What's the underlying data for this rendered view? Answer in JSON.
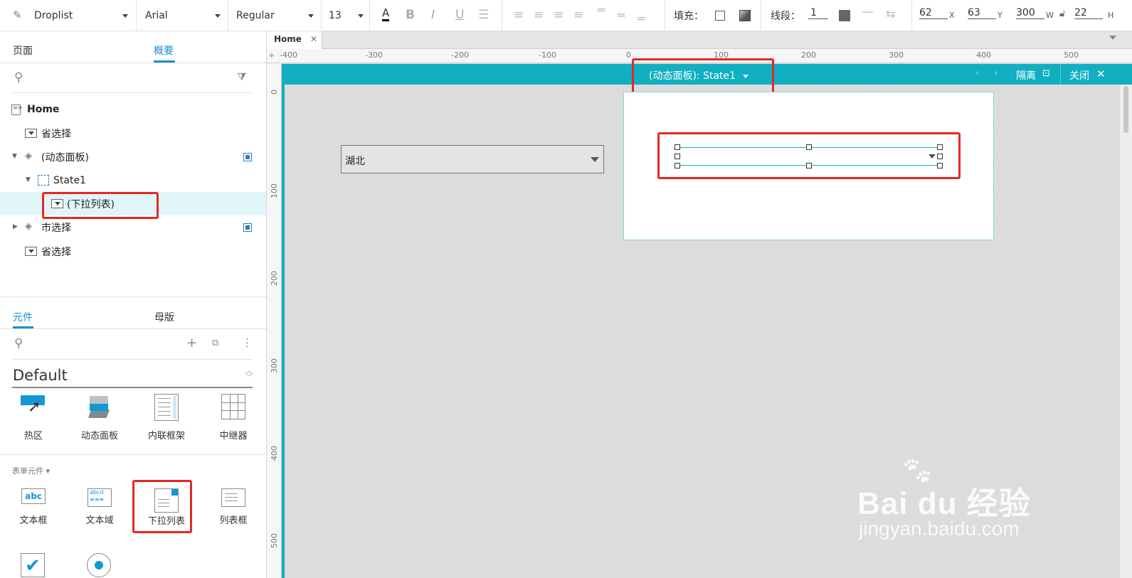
{
  "toolbar": {
    "widget_type": "Droplist",
    "font_family": "Arial",
    "font_style": "Regular",
    "font_size": "13",
    "fill_label": "填充：",
    "stroke_label": "线段：",
    "stroke_value": "1",
    "x_value": "62",
    "x_label": "X",
    "y_value": "63",
    "y_label": "Y",
    "w_value": "300",
    "w_label": "W",
    "h_value": "22",
    "h_label": "H"
  },
  "left_panel": {
    "top_tabs": [
      "页面",
      "概要"
    ],
    "outline": [
      {
        "label": "Home",
        "icon": "page-icon"
      },
      {
        "label": "省选择",
        "icon": "droplist-icon"
      },
      {
        "label": "(动态面板)",
        "icon": "layers-icon"
      },
      {
        "label": "State1",
        "icon": "state-icon"
      },
      {
        "label": "(下拉列表)",
        "icon": "droplist-icon"
      },
      {
        "label": "市选择",
        "icon": "layers-icon"
      },
      {
        "label": "省选择",
        "icon": "droplist-icon"
      }
    ],
    "bottom_tabs": [
      "元件",
      "母版"
    ],
    "library_name": "Default",
    "library_items": [
      "热区",
      "动态面板",
      "内联框架",
      "中继器"
    ],
    "form_section": "表单元件 ▾",
    "form_items": [
      "文本框",
      "文本域",
      "下拉列表",
      "列表框"
    ]
  },
  "canvas": {
    "page_tab": "Home",
    "state_title": "(动态面板): State1",
    "isolate_label": "隔离",
    "close_label": "关闭",
    "droplist_value": "湖北",
    "ruler_h": [
      "-400",
      "-300",
      "-200",
      "-100",
      "0",
      "100",
      "200",
      "300",
      "400",
      "500"
    ],
    "ruler_v": [
      "0",
      "100",
      "200",
      "300",
      "400",
      "500"
    ]
  },
  "watermark": {
    "brand": "Bai du 经验",
    "url": "jingyan.baidu.com"
  },
  "colors": {
    "accent": "#1a8fd0",
    "state_bar": "#12aec1",
    "highlight": "#e52822",
    "selected_row": "#e0f6f9"
  }
}
